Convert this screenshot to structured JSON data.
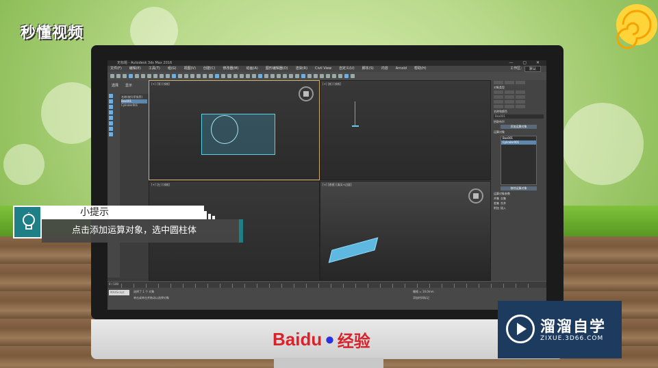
{
  "brand": {
    "top_logo": "秒懂视频",
    "monitor_logo_text": "Baidu",
    "monitor_logo_cn": "经验",
    "watermark_name": "溜溜自学",
    "watermark_url": "ZIXUE.3D66.COM"
  },
  "app": {
    "title": "无标题 - Autodesk 3ds Max 2016",
    "menus": [
      "文件(F)",
      "编辑(E)",
      "工具(T)",
      "组(G)",
      "视图(V)",
      "创建(C)",
      "修改器(M)",
      "动画(A)",
      "图形编辑器(D)",
      "渲染(R)",
      "Civil View",
      "自定义(U)",
      "脚本(S)",
      "内容",
      "Arnold",
      "帮助(H)"
    ],
    "workspace_label": "工作区:",
    "workspace_value": "默认"
  },
  "scene_explorer": {
    "tabs": [
      "选择",
      "显示"
    ],
    "items": [
      "名称(按升序排序)",
      "Box001",
      "Cylinder001"
    ]
  },
  "viewports": [
    {
      "label": "[+] [顶] [线框]"
    },
    {
      "label": "[+] [前] [线框]"
    },
    {
      "label": "[+] [左] [线框]"
    },
    {
      "label": "[+] [透视] [真实+边面]"
    }
  ],
  "command_panel": {
    "object_type": "对象类型",
    "name_color": "名称和颜色",
    "object_name": "Box001",
    "pick_params": "拾取布尔",
    "add_operand_button": "添加运算对象",
    "operands_label": "运算对象",
    "operands": [
      "Box001",
      "Cylinder001"
    ],
    "remove_operand_button": "移除运算对象",
    "operand_params": "运算对象参数",
    "ops": [
      "并集",
      "交集",
      "差集",
      "合并",
      "附加",
      "插入"
    ]
  },
  "status": {
    "script_label": "MAXScript",
    "selection_text": "选择了 1 个 对象",
    "hint_text": "单击或单击并拖动以选择对象",
    "frame": "0 / 100",
    "grid": "栅格 = 10.0mm",
    "add_time_tag": "添加时间标记"
  },
  "tip": {
    "title": "小提示",
    "body": "点击添加运算对象，选中圆柱体"
  }
}
